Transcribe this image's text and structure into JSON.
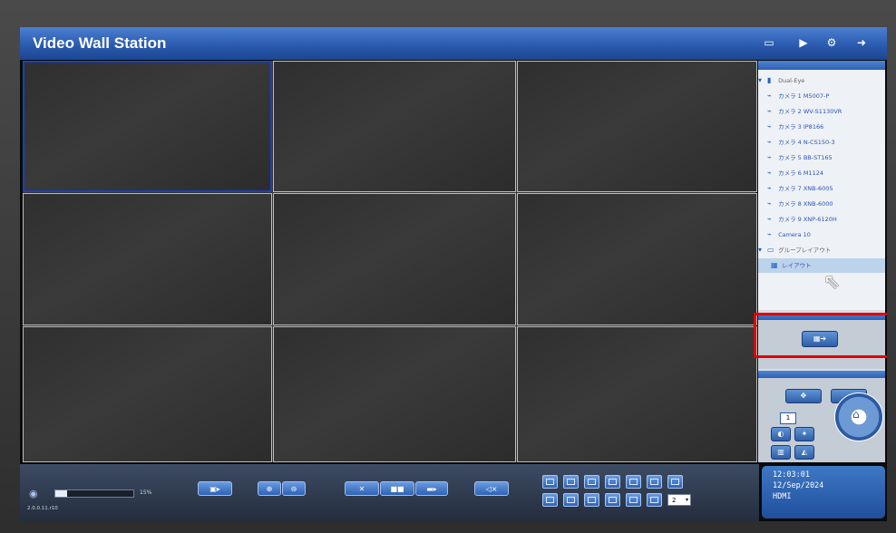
{
  "app": {
    "title": "Video Wall Station"
  },
  "tree": {
    "root": "Dual-Eye",
    "cameras": [
      "カメラ 1 M5007-P",
      "カメラ 2 WV-S1130VR",
      "カメラ 3 IP8166",
      "カメラ 4 N-CS150-3",
      "カメラ 5 BB-ST165",
      "カメラ 6 M1124",
      "カメラ 7 XNB-6005",
      "カメラ 8 XNB-6000",
      "カメラ 9 XNP-6120H",
      "Camera 10"
    ],
    "group": "グループレイアウト",
    "layout_item": "レイアウト"
  },
  "volume": {
    "level_percent": "15%"
  },
  "version": "2.0.0.11.r10",
  "layout_select": {
    "value": "2"
  },
  "ptz": {
    "preset_value": "1"
  },
  "clock": {
    "time": "12:03:01",
    "date": "12/Sep/2024",
    "source": "HDMI"
  },
  "icons": [
    "monitor-icon",
    "play-icon",
    "settings-icon",
    "exit-icon",
    "camera-icon",
    "snapshot-icon",
    "zoom-in-icon",
    "zoom-out-icon",
    "close-icon",
    "record-icon",
    "mute-icon",
    "home-icon"
  ],
  "colors": {
    "accent": "#2a5bb0",
    "selection": "#1c3fb8",
    "highlight": "#e00000"
  }
}
